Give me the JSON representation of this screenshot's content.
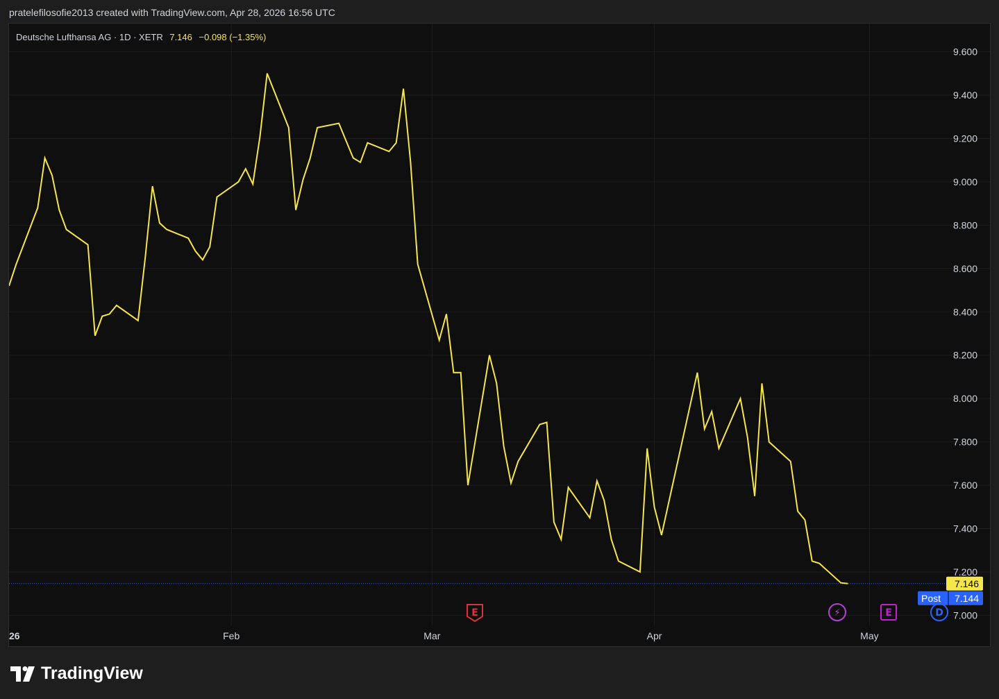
{
  "header": {
    "caption": "pratelefilosofie2013 created with TradingView.com, Apr 28, 2026 16:56 UTC"
  },
  "legend": {
    "symbol": "Deutsche Lufthansa AG · 1D · XETR",
    "last": "7.146",
    "change": "−0.098 (−1.35%)"
  },
  "badges": {
    "last_price": "7.146",
    "post_label": "Post",
    "post_price": "7.144"
  },
  "event_markers": [
    {
      "icon": "earnings-icon",
      "glyph": "E",
      "color": "#e0323c"
    },
    {
      "icon": "split-flash-icon",
      "glyph": "⚡",
      "color": "#b53fd9"
    },
    {
      "icon": "earnings-icon",
      "glyph": "E",
      "color": "#c91fd4"
    },
    {
      "icon": "dividend-icon",
      "glyph": "D",
      "color": "#2962ff"
    }
  ],
  "brand": {
    "name": "TradingView"
  },
  "colors": {
    "line": "#f7e64a",
    "background": "#0f0f0f",
    "grid": "#1f1f1f",
    "post_badge": "#2962ff",
    "axis_text": "#d1d4dc"
  },
  "chart_data": {
    "type": "line",
    "title": "Deutsche Lufthansa AG · 1D · XETR",
    "xlabel": "",
    "ylabel": "",
    "ylim": [
      6.95,
      9.73
    ],
    "y_ticks": [
      7.0,
      7.2,
      7.4,
      7.6,
      7.8,
      8.0,
      8.2,
      8.4,
      8.6,
      8.8,
      9.0,
      9.2,
      9.4,
      9.6
    ],
    "y_tick_labels": [
      "7.000",
      "7.200",
      "7.400",
      "7.600",
      "7.800",
      "8.000",
      "8.200",
      "8.400",
      "8.600",
      "8.800",
      "9.000",
      "9.200",
      "9.400",
      "9.600"
    ],
    "x_ticks": [
      {
        "date": "2026-01-01",
        "label": "26"
      },
      {
        "date": "2026-02-01",
        "label": "Feb"
      },
      {
        "date": "2026-03-01",
        "label": "Mar"
      },
      {
        "date": "2026-04-01",
        "label": "Apr"
      },
      {
        "date": "2026-05-01",
        "label": "May"
      }
    ],
    "xlim": [
      "2026-01-01",
      "2026-05-12"
    ],
    "grid": true,
    "price_line": 7.146,
    "series": [
      {
        "name": "Deutsche Lufthansa AG",
        "x": [
          "2026-01-01",
          "2026-01-02",
          "2026-01-05",
          "2026-01-06",
          "2026-01-07",
          "2026-01-08",
          "2026-01-09",
          "2026-01-12",
          "2026-01-13",
          "2026-01-14",
          "2026-01-15",
          "2026-01-16",
          "2026-01-19",
          "2026-01-20",
          "2026-01-21",
          "2026-01-22",
          "2026-01-23",
          "2026-01-26",
          "2026-01-27",
          "2026-01-28",
          "2026-01-29",
          "2026-01-30",
          "2026-02-02",
          "2026-02-03",
          "2026-02-04",
          "2026-02-05",
          "2026-02-06",
          "2026-02-09",
          "2026-02-10",
          "2026-02-11",
          "2026-02-12",
          "2026-02-13",
          "2026-02-16",
          "2026-02-17",
          "2026-02-18",
          "2026-02-19",
          "2026-02-20",
          "2026-02-23",
          "2026-02-24",
          "2026-02-25",
          "2026-02-26",
          "2026-02-27",
          "2026-03-02",
          "2026-03-03",
          "2026-03-04",
          "2026-03-05",
          "2026-03-06",
          "2026-03-09",
          "2026-03-10",
          "2026-03-11",
          "2026-03-12",
          "2026-03-13",
          "2026-03-16",
          "2026-03-17",
          "2026-03-18",
          "2026-03-19",
          "2026-03-20",
          "2026-03-23",
          "2026-03-24",
          "2026-03-25",
          "2026-03-26",
          "2026-03-27",
          "2026-03-30",
          "2026-03-31",
          "2026-04-01",
          "2026-04-02",
          "2026-04-07",
          "2026-04-08",
          "2026-04-09",
          "2026-04-10",
          "2026-04-13",
          "2026-04-14",
          "2026-04-15",
          "2026-04-16",
          "2026-04-17",
          "2026-04-20",
          "2026-04-21",
          "2026-04-22",
          "2026-04-23",
          "2026-04-24",
          "2026-04-27",
          "2026-04-28"
        ],
        "values": [
          8.52,
          8.62,
          8.88,
          9.11,
          9.03,
          8.87,
          8.78,
          8.71,
          8.29,
          8.38,
          8.39,
          8.43,
          8.36,
          8.65,
          8.98,
          8.81,
          8.78,
          8.74,
          8.68,
          8.64,
          8.7,
          8.93,
          9.0,
          9.06,
          8.99,
          9.21,
          9.5,
          9.25,
          8.87,
          9.01,
          9.11,
          9.25,
          9.27,
          9.19,
          9.11,
          9.09,
          9.18,
          9.14,
          9.18,
          9.43,
          9.09,
          8.62,
          8.27,
          8.39,
          8.12,
          8.12,
          7.6,
          8.2,
          8.07,
          7.78,
          7.61,
          7.71,
          7.88,
          7.89,
          7.43,
          7.35,
          7.59,
          7.45,
          7.62,
          7.53,
          7.35,
          7.25,
          7.2,
          7.77,
          7.5,
          7.37,
          8.12,
          7.86,
          7.94,
          7.77,
          8.0,
          7.82,
          7.55,
          8.07,
          7.8,
          7.71,
          7.48,
          7.44,
          7.25,
          7.24,
          7.15,
          7.146
        ]
      }
    ]
  }
}
